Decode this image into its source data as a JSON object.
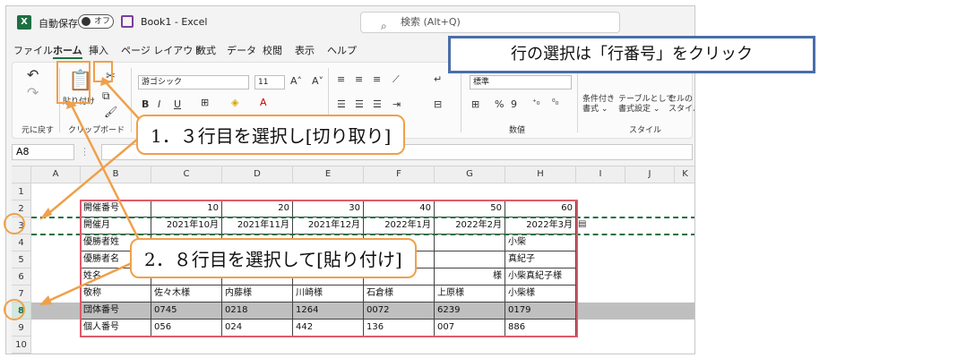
{
  "title_bar": {
    "autosave_label": "自動保存",
    "autosave_state": "オフ",
    "workbook": "Book1  -  Excel",
    "search_placeholder": "検索 (Alt+Q)"
  },
  "menu": [
    "ファイル",
    "ホーム",
    "挿入",
    "ページ レイアウト",
    "数式",
    "データ",
    "校閲",
    "表示",
    "ヘルプ"
  ],
  "ribbon": {
    "undo_label": "元に戻す",
    "clipboard_label": "クリップボード",
    "paste_label": "貼り付け",
    "font_name": "游ゴシック",
    "font_size": "11",
    "number_format": "標準",
    "number_label": "数値",
    "style_label": "スタイル",
    "cond_format": "条件付き\n書式 ⌄",
    "table_format": "テーブルとして\n書式設定 ⌄",
    "cell_style": "セルの\nスタイル ⌄",
    "bold": "B",
    "italic": "I",
    "underline": "U",
    "percent": "%",
    "comma": "9"
  },
  "name_box": "A8",
  "columns": [
    "A",
    "B",
    "C",
    "D",
    "E",
    "F",
    "G",
    "H",
    "I",
    "J",
    "K"
  ],
  "rows": [
    "1",
    "2",
    "3",
    "4",
    "5",
    "6",
    "7",
    "8",
    "9",
    "10"
  ],
  "cells": {
    "row2": [
      "開催番号",
      "10",
      "20",
      "30",
      "40",
      "50",
      "60"
    ],
    "row3": [
      "開催月",
      "2021年10月",
      "2021年11月",
      "2021年12月",
      "2022年1月",
      "2022年2月",
      "2022年3月"
    ],
    "row4": [
      "優勝者姓",
      "",
      "",
      "",
      "",
      "",
      "小柴"
    ],
    "row5": [
      "優勝者名",
      "",
      "",
      "",
      "",
      "",
      "真紀子"
    ],
    "row6": [
      "姓名",
      "",
      "",
      "",
      "",
      "様",
      "小柴真紀子様"
    ],
    "row7": [
      "敬称",
      "佐々木様",
      "内藤様",
      "川崎様",
      "石倉様",
      "上原様",
      "小柴様"
    ],
    "row8": [
      "団体番号",
      "0745",
      "0218",
      "1264",
      "0072",
      "6239",
      "0179"
    ],
    "row9": [
      "個人番号",
      "056",
      "024",
      "442",
      "136",
      "007",
      "886"
    ]
  },
  "callouts": {
    "step1": "1．３行目を選択し[切り取り]",
    "step2": "2．８行目を選択して[貼り付け]",
    "info": "行の選択は「行番号」をクリック"
  }
}
